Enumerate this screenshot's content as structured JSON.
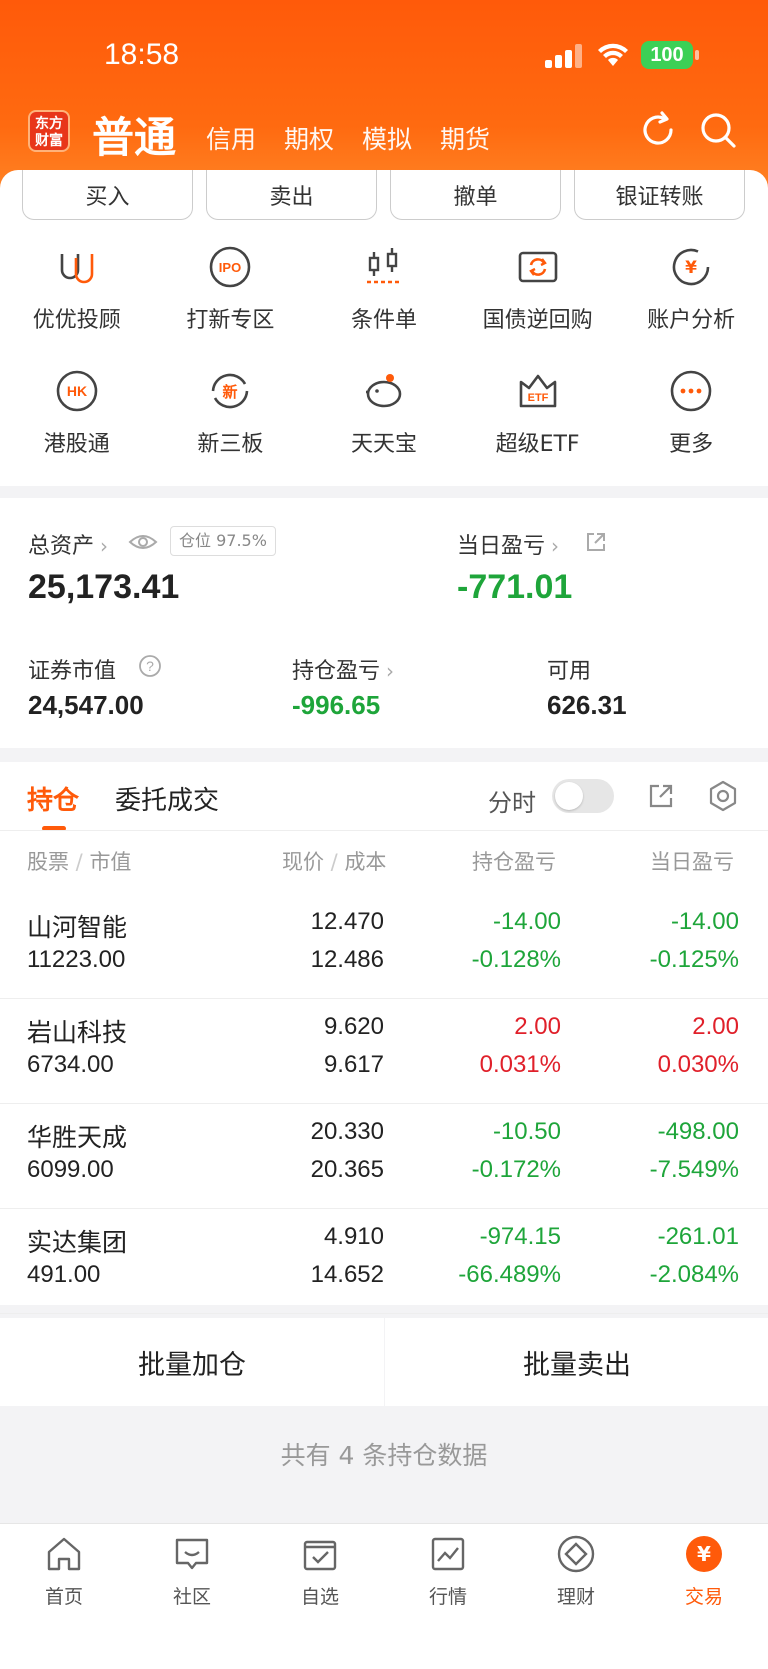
{
  "status": {
    "time": "18:58",
    "battery": "100"
  },
  "header": {
    "logo_text_1": "东方",
    "logo_text_2": "财富",
    "main_tab": "普通",
    "tabs": [
      "信用",
      "期权",
      "模拟",
      "期货"
    ]
  },
  "quick_buttons": [
    "买入",
    "卖出",
    "撤单",
    "银证转账"
  ],
  "grid": [
    {
      "label": "优优投顾",
      "icon": "youyou-icon"
    },
    {
      "label": "打新专区",
      "icon": "ipo-icon"
    },
    {
      "label": "条件单",
      "icon": "candlestick-icon"
    },
    {
      "label": "国债逆回购",
      "icon": "repo-icon"
    },
    {
      "label": "账户分析",
      "icon": "yuan-analysis-icon"
    },
    {
      "label": "港股通",
      "icon": "hk-icon"
    },
    {
      "label": "新三板",
      "icon": "new-board-icon"
    },
    {
      "label": "天天宝",
      "icon": "piggy-bank-icon"
    },
    {
      "label": "超级ETF",
      "icon": "etf-icon"
    },
    {
      "label": "更多",
      "icon": "more-icon"
    }
  ],
  "assets": {
    "total_label": "总资产",
    "position_badge": "仓位 97.5%",
    "total_value": "25,173.41",
    "daily_pl_label": "当日盈亏",
    "daily_pl_value": "-771.01",
    "market_value_label": "证券市值",
    "market_value": "24,547.00",
    "position_pl_label": "持仓盈亏",
    "position_pl_value": "-996.65",
    "available_label": "可用",
    "available_value": "626.31"
  },
  "positions": {
    "tab_active": "持仓",
    "tab_other": "委托成交",
    "intraday_label": "分时",
    "headers": {
      "stock": "股票",
      "market_value": "市值",
      "price": "现价",
      "cost": "成本",
      "pos_pl": "持仓盈亏",
      "day_pl": "当日盈亏"
    },
    "rows": [
      {
        "name": "山河智能",
        "mv": "11223.00",
        "price": "12.470",
        "cost": "12.486",
        "pl": "-14.00",
        "pl_pct": "-0.128%",
        "dpl": "-14.00",
        "dpl_pct": "-0.125%",
        "dir": "down"
      },
      {
        "name": "岩山科技",
        "mv": "6734.00",
        "price": "9.620",
        "cost": "9.617",
        "pl": "2.00",
        "pl_pct": "0.031%",
        "dpl": "2.00",
        "dpl_pct": "0.030%",
        "dir": "up"
      },
      {
        "name": "华胜天成",
        "mv": "6099.00",
        "price": "20.330",
        "cost": "20.365",
        "pl": "-10.50",
        "pl_pct": "-0.172%",
        "dpl": "-498.00",
        "dpl_pct": "-7.549%",
        "dir": "down"
      },
      {
        "name": "实达集团",
        "mv": "491.00",
        "price": "4.910",
        "cost": "14.652",
        "pl": "-974.15",
        "pl_pct": "-66.489%",
        "dpl": "-261.01",
        "dpl_pct": "-2.084%",
        "dir": "down"
      }
    ]
  },
  "batch": {
    "add": "批量加仓",
    "sell": "批量卖出"
  },
  "total_note": "共有 4 条持仓数据",
  "bottom_nav": [
    {
      "label": "首页",
      "icon": "home-icon"
    },
    {
      "label": "社区",
      "icon": "community-icon"
    },
    {
      "label": "自选",
      "icon": "watchlist-icon"
    },
    {
      "label": "行情",
      "icon": "market-icon"
    },
    {
      "label": "理财",
      "icon": "wealth-icon"
    },
    {
      "label": "交易",
      "icon": "trade-icon"
    }
  ],
  "colors": {
    "accent": "#ff5a0a",
    "up": "#e0202a",
    "down": "#1ea53a"
  }
}
